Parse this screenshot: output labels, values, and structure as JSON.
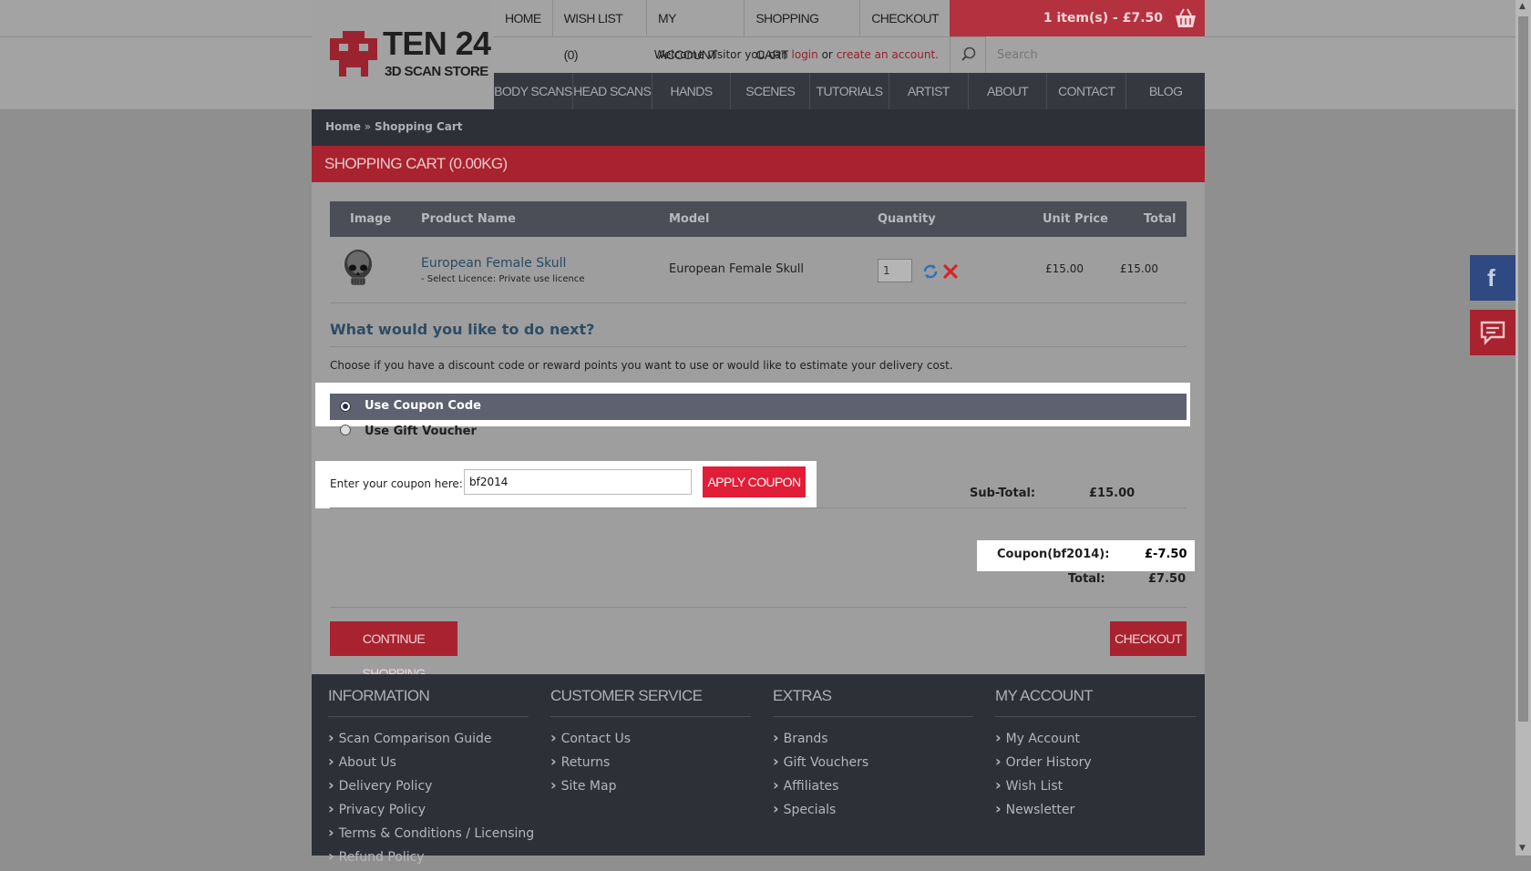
{
  "header": {
    "logo_title": "TEN 24",
    "logo_subtitle": "3D SCAN STORE",
    "top_nav": [
      "HOME",
      "WISH LIST (0)",
      "MY ACCOUNT",
      "SHOPPING CART",
      "CHECKOUT"
    ],
    "cart_summary": "1 item(s) - £7.50",
    "welcome_prefix": "Welcome visitor you can",
    "login_link": "login",
    "or_text": "or",
    "create_link": "create an account.",
    "search_placeholder": "Search",
    "main_nav": [
      "BODY SCANS",
      "HEAD SCANS",
      "HANDS",
      "SCENES",
      "TUTORIALS",
      "ARTIST TOOLS",
      "ABOUT",
      "CONTACT",
      "BLOG"
    ]
  },
  "breadcrumb": {
    "home": "Home",
    "separator": "»",
    "current": "Shopping Cart"
  },
  "page_title": "SHOPPING CART  (0.00KG)",
  "cart": {
    "headers": {
      "image": "Image",
      "product": "Product Name",
      "model": "Model",
      "quantity": "Quantity",
      "unit_price": "Unit Price",
      "total": "Total"
    },
    "item": {
      "name": "European Female Skull",
      "option": "- Select Licence: Private use licence",
      "model": "European Female Skull",
      "quantity": "1",
      "unit_price": "£15.00",
      "total": "£15.00"
    }
  },
  "next": {
    "heading": "What would you like to do next?",
    "description": "Choose if you have a discount code or reward points you want to use or would like to estimate your delivery cost.",
    "option_coupon": "Use Coupon Code",
    "option_voucher": "Use Gift Voucher",
    "coupon_label": "Enter your coupon here:",
    "coupon_value": "bf2014",
    "apply_label": "APPLY COUPON"
  },
  "totals": {
    "subtotal_label": "Sub-Total:",
    "subtotal_value": "£15.00",
    "coupon_label": "Coupon(bf2014):",
    "coupon_value": "£-7.50",
    "total_label": "Total:",
    "total_value": "£7.50"
  },
  "buttons": {
    "continue": "CONTINUE SHOPPING",
    "checkout": "CHECKOUT"
  },
  "footer": {
    "information": {
      "title": "INFORMATION",
      "links": [
        "Scan Comparison Guide",
        "About Us",
        "Delivery Policy",
        "Privacy Policy",
        "Terms & Conditions / Licensing",
        "Refund Policy"
      ]
    },
    "customer_service": {
      "title": "CUSTOMER SERVICE",
      "links": [
        "Contact Us",
        "Returns",
        "Site Map"
      ]
    },
    "extras": {
      "title": "EXTRAS",
      "links": [
        "Brands",
        "Gift Vouchers",
        "Affiliates",
        "Specials"
      ]
    },
    "my_account": {
      "title": "MY ACCOUNT",
      "links": [
        "My Account",
        "Order History",
        "Wish List",
        "Newsletter"
      ]
    }
  },
  "side": {
    "facebook_glyph": "f"
  },
  "colors": {
    "brand_red": "#a8232f",
    "coupon_red": "#e11d38",
    "dark": "#2e3038",
    "facebook": "#2f4a82"
  }
}
